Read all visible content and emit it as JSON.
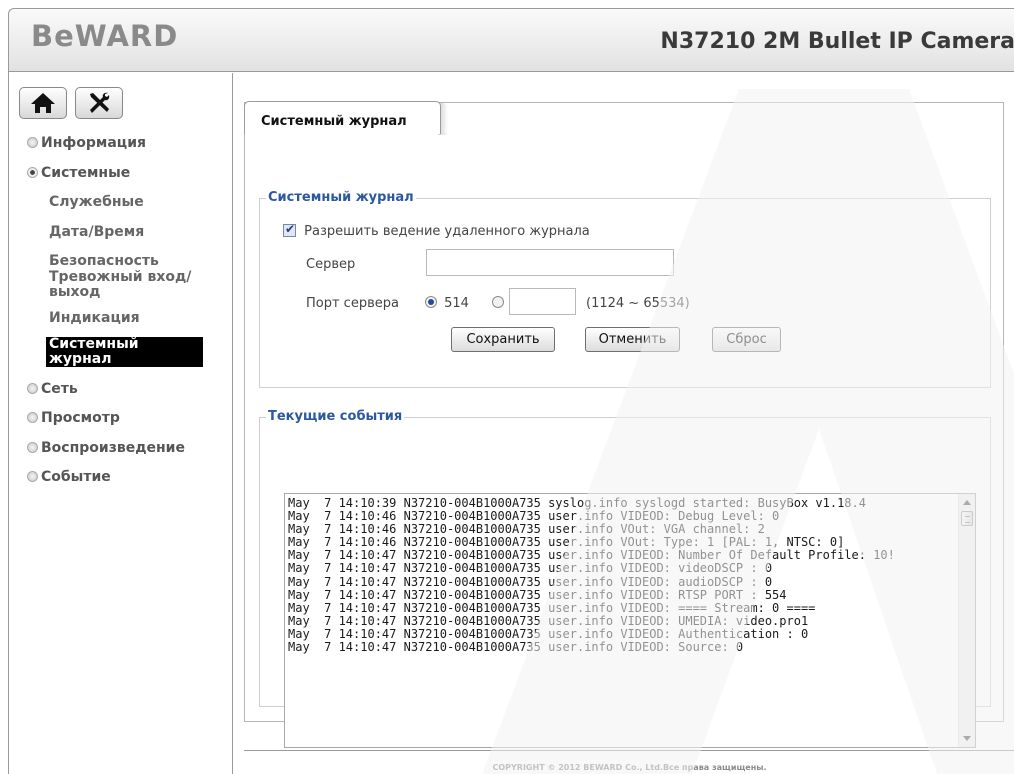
{
  "header": {
    "logo": "BeWARD",
    "camera_title": "N37210 2M Bullet IP Camera"
  },
  "nav": {
    "home_icon": "home-icon",
    "settings_icon": "tools-icon",
    "menu": [
      {
        "label": "Информация",
        "state": "collapsed"
      },
      {
        "label": "Системные",
        "state": "expanded"
      },
      {
        "label": "Сеть",
        "state": "collapsed"
      },
      {
        "label": "Просмотр",
        "state": "collapsed"
      },
      {
        "label": "Воспроизведение",
        "state": "collapsed"
      },
      {
        "label": "Событие",
        "state": "collapsed"
      }
    ],
    "system_sub": [
      {
        "label": "Служебные"
      },
      {
        "label": "Дата/Время"
      },
      {
        "label": "Безопасность"
      },
      {
        "label": "Тревожный вход/выход"
      },
      {
        "label": "Индикация"
      },
      {
        "label": "Системный журнал",
        "active": true
      }
    ]
  },
  "tab": {
    "label": "Системный журнал"
  },
  "syslog": {
    "legend": "Системный журнал",
    "remote_checkbox_label": "Разрешить ведение удаленного журнала",
    "remote_checked": true,
    "server_label": "Сервер",
    "server_value": "",
    "port_label": "Порт сервера",
    "port_default": "514",
    "port_default_selected": true,
    "port_custom_value": "",
    "port_range": "(1124 ~ 65534)",
    "save_button": "Сохранить",
    "cancel_button": "Отменить",
    "reset_button": "Сброс"
  },
  "events": {
    "legend": "Текущие события",
    "log_text": "May  7 14:10:39 N37210-004B1000A735 syslog.info syslogd started: BusyBox v1.18.4\nMay  7 14:10:46 N37210-004B1000A735 user.info VIDEOD: Debug Level: 0\nMay  7 14:10:46 N37210-004B1000A735 user.info VOut: VGA channel: 2\nMay  7 14:10:46 N37210-004B1000A735 user.info VOut: Type: 1 [PAL: 1, NTSC: 0]\nMay  7 14:10:47 N37210-004B1000A735 user.info VIDEOD: Number Of Default Profile: 10!\nMay  7 14:10:47 N37210-004B1000A735 user.info VIDEOD: videoDSCP : 0\nMay  7 14:10:47 N37210-004B1000A735 user.info VIDEOD: audioDSCP : 0\nMay  7 14:10:47 N37210-004B1000A735 user.info VIDEOD: RTSP PORT : 554\nMay  7 14:10:47 N37210-004B1000A735 user.info VIDEOD: ==== Stream: 0 ====\nMay  7 14:10:47 N37210-004B1000A735 user.info VIDEOD: UMEDIA: video.pro1\nMay  7 14:10:47 N37210-004B1000A735 user.info VIDEOD: Authentication : 0\nMay  7 14:10:47 N37210-004B1000A735 user.info VIDEOD: Source: 0"
  },
  "footer": {
    "copyright": "COPYRIGHT © 2012 BEWARD Co., Ltd.Все права защищены."
  },
  "colors": {
    "legend": "#2c58a0",
    "active_menu_bg": "#000000",
    "watermark": "#f2f2f2"
  }
}
